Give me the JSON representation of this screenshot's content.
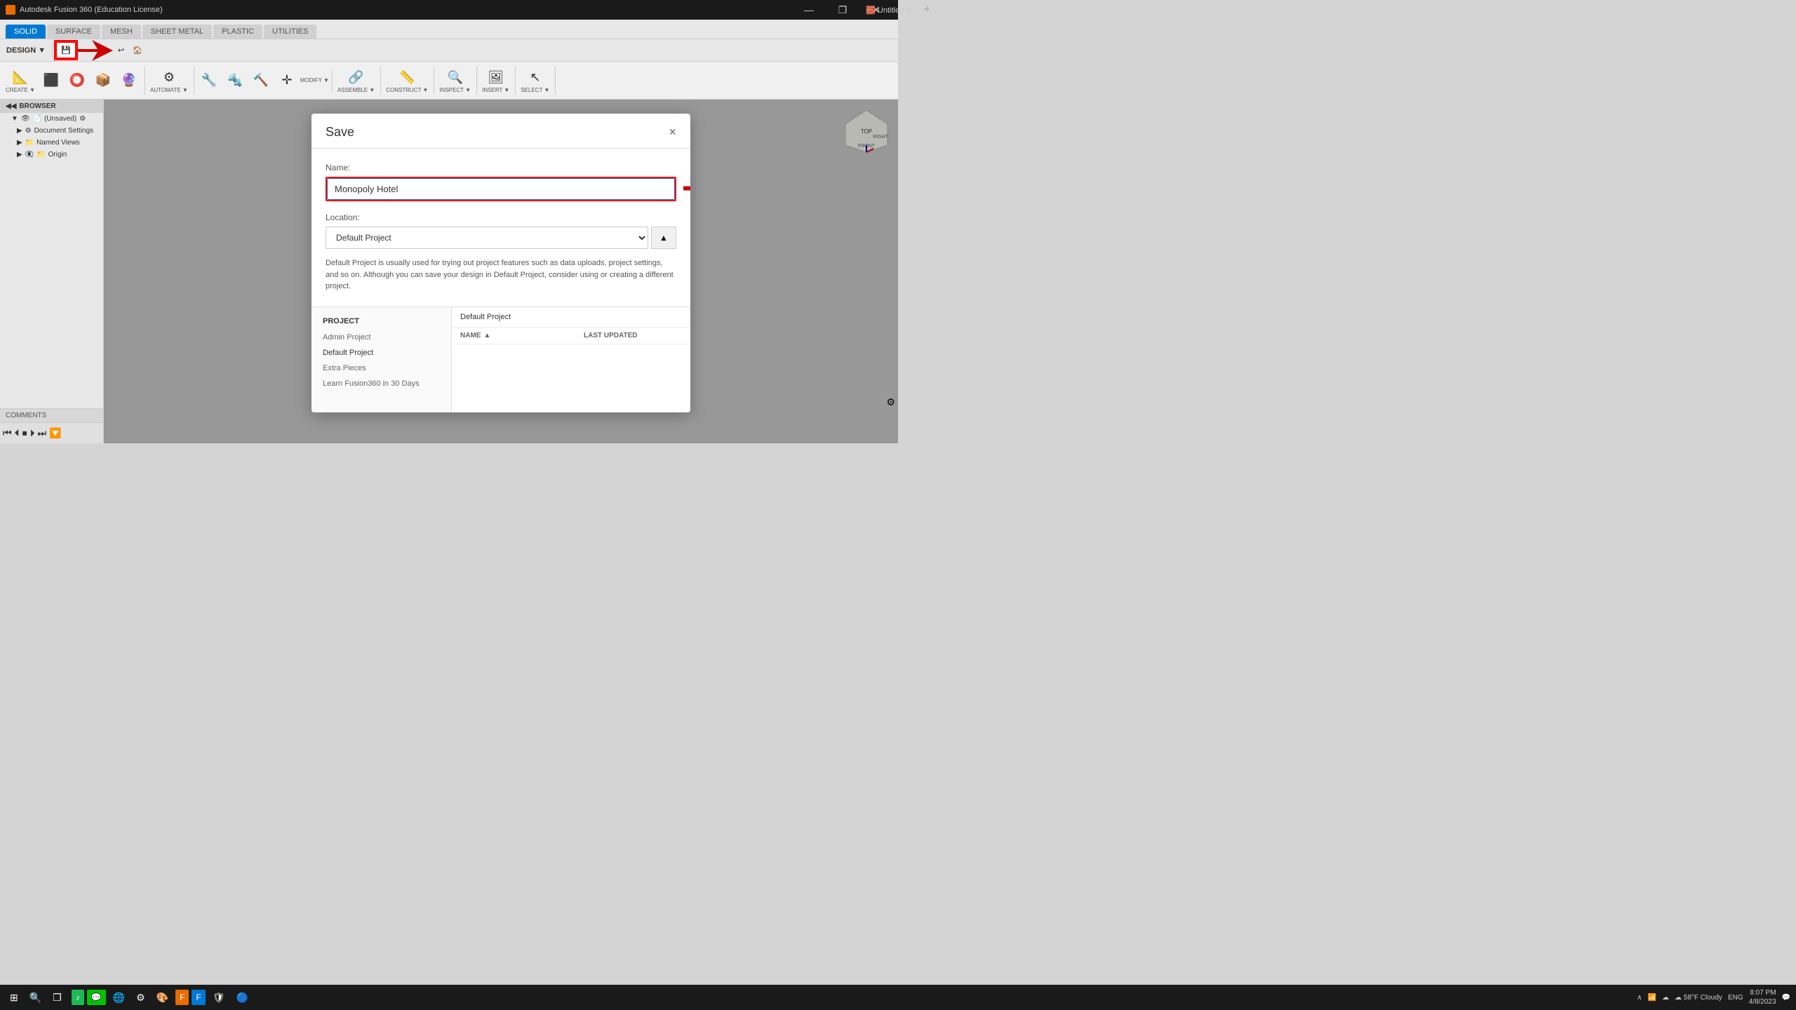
{
  "app": {
    "title": "Autodesk Fusion 360 (Education License)",
    "tab_label": "Untitled",
    "tab_close": "×"
  },
  "title_bar": {
    "controls": [
      "—",
      "❐",
      "✕"
    ]
  },
  "toolbar": {
    "design_label": "DESIGN",
    "tabs": [
      "SOLID",
      "SURFACE",
      "MESH",
      "SHEET METAL",
      "PLASTIC",
      "UTILITIES"
    ],
    "active_tab": "SOLID",
    "groups": {
      "create": "CREATE",
      "automate": "AUTOMATE",
      "modify": "MODIFY",
      "assemble": "ASSEMBLE",
      "construct": "CONSTRUCT",
      "inspect": "INSPECT",
      "insert": "INSERT",
      "select": "SELECT"
    }
  },
  "sidebar": {
    "header": "BROWSER",
    "items": [
      {
        "label": "(Unsaved)",
        "indent": 0
      },
      {
        "label": "Document Settings",
        "indent": 1
      },
      {
        "label": "Named Views",
        "indent": 1
      },
      {
        "label": "Origin",
        "indent": 1
      }
    ],
    "comments": "COMMENTS"
  },
  "dialog": {
    "title": "Save",
    "close_label": "×",
    "name_label": "Name:",
    "name_value": "Monopoly Hotel",
    "location_label": "Location:",
    "location_value": "Default Project",
    "location_btn": "▲",
    "info_text": "Default Project is usually used for trying out project features such as data uploads, project settings, and so on. Although you can save your design in Default Project, consider using or creating a different project.",
    "projects_header": "PROJECT",
    "projects": [
      {
        "label": "Admin Project"
      },
      {
        "label": "Default Project"
      },
      {
        "label": "Extra Pieces"
      },
      {
        "label": "Learn Fusion360 in 30 Days"
      }
    ],
    "files_header": "Default Project",
    "files_col_name": "NAME",
    "files_col_date": "LAST UPDATED",
    "sort_arrow": "▲"
  },
  "playback": {
    "controls": [
      "⏮",
      "⏴",
      "⏹",
      "⏵",
      "⏭"
    ],
    "filter_icon": "🔽"
  },
  "taskbar": {
    "start": "⊞",
    "search": "🔍",
    "task_view": "❐",
    "weather": "☁ 58°F Cloudy",
    "time": "8:07 PM",
    "date": "4/8/2023",
    "lang": "ENG"
  }
}
